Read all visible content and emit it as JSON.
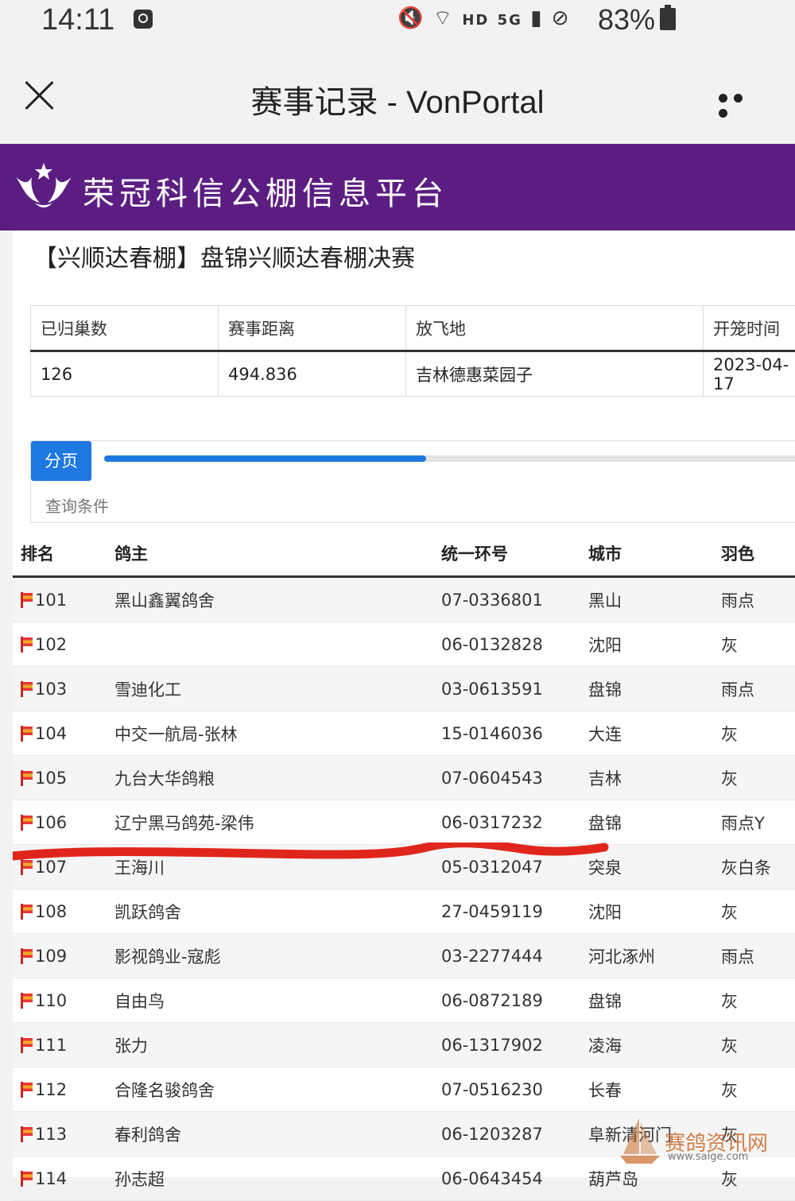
{
  "status_bar": {
    "time": "14:11",
    "network_label": "HD",
    "cellular_label": "5G",
    "battery": "83%"
  },
  "titlebar": {
    "title": "赛事记录 - VonPortal"
  },
  "banner": {
    "title": "荣冠科信公棚信息平台",
    "color": "#5b1d82"
  },
  "race": {
    "title": "【兴顺达春棚】盘锦兴顺达春棚决赛",
    "summary_headers": [
      "已归巢数",
      "赛事距离",
      "放飞地",
      "开笼时间"
    ],
    "summary_values": [
      "126",
      "494.836",
      "吉林德惠菜园子",
      "2023-04-17"
    ]
  },
  "panel": {
    "tab_label": "分页",
    "progress": 0.46,
    "query_label": "查询条件"
  },
  "results": {
    "headers": {
      "rank": "排名",
      "owner": "鸽主",
      "ring": "统一环号",
      "city": "城市",
      "color": "羽色"
    },
    "rows": [
      {
        "rank": "101",
        "owner": "黑山鑫翼鸽舍",
        "ring": "07-0336801",
        "city": "黑山",
        "color": "雨点"
      },
      {
        "rank": "102",
        "owner": "",
        "ring": "06-0132828",
        "city": "沈阳",
        "color": "灰"
      },
      {
        "rank": "103",
        "owner": "雪迪化工",
        "ring": "03-0613591",
        "city": "盘锦",
        "color": "雨点"
      },
      {
        "rank": "104",
        "owner": "中交一航局-张林",
        "ring": "15-0146036",
        "city": "大连",
        "color": "灰"
      },
      {
        "rank": "105",
        "owner": "九台大华鸽粮",
        "ring": "07-0604543",
        "city": "吉林",
        "color": "灰"
      },
      {
        "rank": "106",
        "owner": "辽宁黑马鸽苑-梁伟",
        "ring": "06-0317232",
        "city": "盘锦",
        "color": "雨点Y"
      },
      {
        "rank": "107",
        "owner": "王海川",
        "ring": "05-0312047",
        "city": "突泉",
        "color": "灰白条"
      },
      {
        "rank": "108",
        "owner": "凯跃鸽舍",
        "ring": "27-0459119",
        "city": "沈阳",
        "color": "灰"
      },
      {
        "rank": "109",
        "owner": "影视鸽业-寇彪",
        "ring": "03-2277444",
        "city": "河北涿州",
        "color": "雨点"
      },
      {
        "rank": "110",
        "owner": "自由鸟",
        "ring": "06-0872189",
        "city": "盘锦",
        "color": "灰"
      },
      {
        "rank": "111",
        "owner": "张力",
        "ring": "06-1317902",
        "city": "凌海",
        "color": "灰"
      },
      {
        "rank": "112",
        "owner": "合隆名骏鸽舍",
        "ring": "07-0516230",
        "city": "长春",
        "color": "灰"
      },
      {
        "rank": "113",
        "owner": "春利鸽舍",
        "ring": "06-1203287",
        "city": "阜新清河门",
        "color": "灰"
      },
      {
        "rank": "114",
        "owner": "孙志超",
        "ring": "06-0643454",
        "city": "葫芦岛",
        "color": "灰"
      }
    ]
  },
  "watermark": {
    "title": "赛鸽资讯网",
    "url": "www.saige.com"
  }
}
